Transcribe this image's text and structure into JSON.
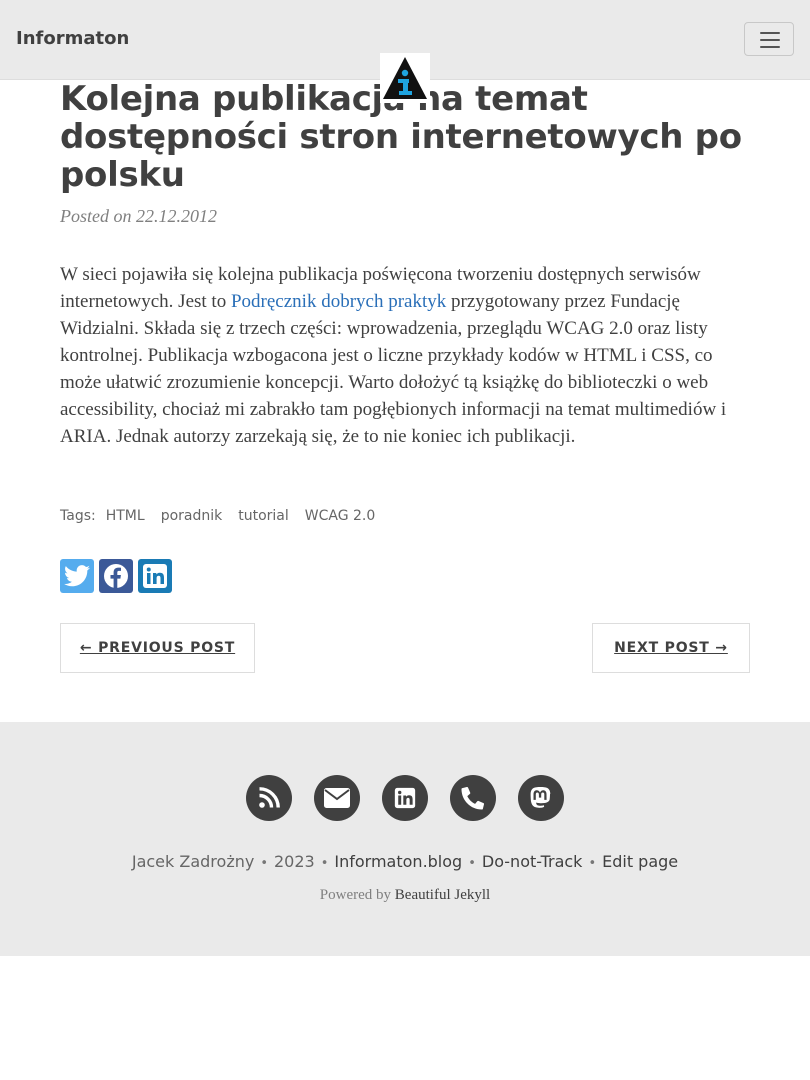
{
  "navbar": {
    "brand": "Informaton",
    "menu_icon": "hamburger-menu-icon",
    "avatar_icon": "info-logo-icon"
  },
  "post": {
    "title": "Kolejna publikacja na temat dostępności stron internetowych po polsku",
    "meta": "Posted on 22.12.2012",
    "body_before_link": "W sieci pojawiła się kolejna publikacja poświęcona tworzeniu dostępnych serwisów internetowych. Jest to ",
    "link_text": "Podręcznik dobrych praktyk",
    "body_after_link": " przygotowany przez Fundację Widzialni. Składa się z trzech części: wprowadzenia, przeglądu WCAG 2.0 oraz listy kontrolnej. Publikacja wzbogacona jest o liczne przykłady kodów w HTML i CSS, co może ułatwić zrozumienie koncepcji. Warto dołożyć tą książkę do biblioteczki o web accessibility, chociaż mi zabrakło tam pogłębionych informacji na temat multimediów i ARIA. Jednak autorzy zarzekają się, że to nie koniec ich publikacji."
  },
  "tags": {
    "label": "Tags:",
    "items": [
      "HTML",
      "poradnik",
      "tutorial",
      "WCAG 2.0"
    ]
  },
  "share": {
    "icons": [
      "twitter-icon",
      "facebook-icon",
      "linkedin-icon"
    ],
    "colors": {
      "twitter": "#55acee",
      "facebook": "#3b5998",
      "linkedin": "#1a7bb5"
    }
  },
  "pager": {
    "previous": "← PREVIOUS POST",
    "next": "NEXT POST →"
  },
  "footer": {
    "social_icons": [
      "rss-icon",
      "email-icon",
      "linkedin-icon",
      "phone-icon",
      "mastodon-icon"
    ],
    "author": "Jacek Zadrożny",
    "year": "2023",
    "site": "Informaton.blog",
    "dnt": "Do-not-Track",
    "edit": "Edit page",
    "powered_prefix": "Powered by",
    "powered_link": "Beautiful Jekyll"
  },
  "colors": {
    "navbar_bg": "#eaeaea",
    "link": "#2a6fb8",
    "text": "#404040"
  }
}
